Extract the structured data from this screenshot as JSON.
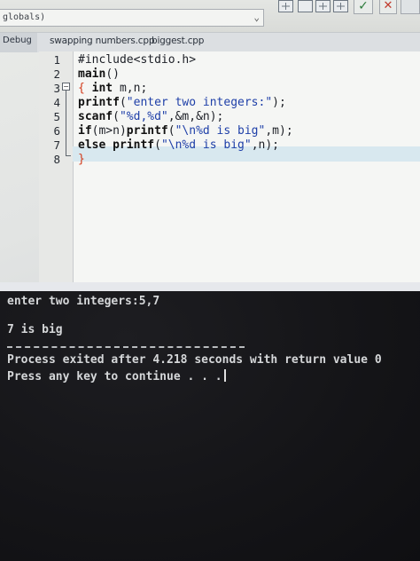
{
  "toolbar": {
    "scope_combo": "globals)",
    "scope_arrow": "⌄",
    "check_icon": "✓",
    "close_icon": "✕"
  },
  "tabs": {
    "left_panel": "Debug",
    "files": [
      "swapping numbers.cpp",
      "biggest.cpp"
    ]
  },
  "editor": {
    "line_numbers": [
      "1",
      "2",
      "3",
      "4",
      "5",
      "6",
      "7",
      "8"
    ],
    "lines": [
      "#include<stdio.h>",
      "main()",
      "{ int m,n;",
      "printf(\"enter two integers:\");",
      "scanf(\"%d,%d\",&m,&n);",
      "if(m>n)printf(\"\\n%d is big\",m);",
      "else printf(\"\\n%d is big\",n);",
      "}"
    ]
  },
  "console": {
    "prompt_line": "enter two integers:5,7",
    "result_line": "7 is big",
    "separator": "--------------------------------",
    "exit_line": "Process exited after 4.218 seconds with return value 0",
    "continue_line": "Press any key to continue . . ."
  },
  "colors": {
    "keyword": "#111111",
    "string": "#1e3fa8",
    "brace": "#d23a1a",
    "current_line": "#d8e8ef",
    "console_text": "#d5d7d9"
  },
  "icons": [
    "grid-icon",
    "check-icon",
    "close-icon",
    "fold-icon",
    "text-cursor"
  ]
}
